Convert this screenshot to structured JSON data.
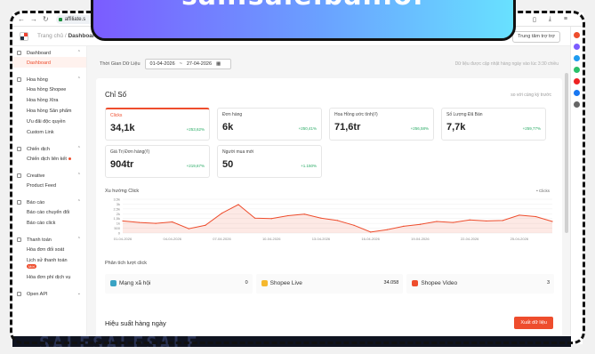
{
  "banner": {
    "text": "san.sale.ban.of"
  },
  "browser": {
    "url": "affiliate.s"
  },
  "header": {
    "crumb_root": "Trang chủ",
    "crumb_current": "Dashboard",
    "help_button": "Trung tâm trợ trợ"
  },
  "sidebar": {
    "groups": [
      {
        "label": "Dashboard",
        "items": [
          "Dashboard"
        ]
      },
      {
        "label": "Hoa hồng",
        "items": [
          "Hoa hồng Shopee",
          "Hoa hồng Xtra",
          "Hoa hồng Sản phẩm",
          "Ưu đãi độc quyền",
          "Custom Link"
        ]
      },
      {
        "label": "Chiến dịch",
        "items": [
          "Chiến dịch liên kết"
        ]
      },
      {
        "label": "Creative",
        "items": [
          "Product Feed"
        ]
      },
      {
        "label": "Báo cáo",
        "items": [
          "Báo cáo chuyển đổi",
          "Báo cáo click"
        ]
      },
      {
        "label": "Thanh toán",
        "items": [
          "Hóa đơn đối soát",
          "Lịch sử thanh toán",
          "Hóa đơn phí dịch vụ"
        ]
      },
      {
        "label": "Open API",
        "items": []
      }
    ],
    "badge": "Mới"
  },
  "filter": {
    "label": "Thời Gian Dữ Liệu",
    "start": "01-04-2026",
    "end": "27-04-2026",
    "sep": "~",
    "note": "Dữ liệu được cập nhật hàng ngày vào lúc 3:30 chiều"
  },
  "metrics_section": {
    "title": "Chỉ Số",
    "compare": "so với cùng kỳ trước",
    "items": [
      {
        "label": "Clicks",
        "value": "34,1k",
        "change": "+253,62%"
      },
      {
        "label": "Đơn hàng",
        "value": "6k",
        "change": "+250,41%"
      },
      {
        "label": "Hoa Hồng ước tính(₫)",
        "value": "71,6tr",
        "change": "+256,58%"
      },
      {
        "label": "Số Lượng Đã Bán",
        "value": "7,7k",
        "change": "+259,77%"
      },
      {
        "label": "Giá Trị Đơn hàng(₫)",
        "value": "904tr",
        "change": "+219,67%"
      },
      {
        "label": "Người mua mới",
        "value": "50",
        "change": "+1.150%"
      }
    ]
  },
  "chart_data": {
    "type": "area",
    "title": "Xu hướng Click",
    "legend": "Clicks",
    "x": [
      "01-04-2026",
      "02-04-2026",
      "03-04-2026",
      "04-04-2026",
      "05-04-2026",
      "06-04-2026",
      "07-04-2026",
      "08-04-2026",
      "09-04-2026",
      "10-04-2026",
      "11-04-2026",
      "12-04-2026",
      "13-04-2026",
      "14-04-2026",
      "15-04-2026",
      "16-04-2026",
      "17-04-2026",
      "18-04-2026",
      "19-04-2026",
      "20-04-2026",
      "21-04-2026",
      "22-04-2026",
      "23-04-2026",
      "24-04-2026",
      "25-04-2026",
      "26-04-2026",
      "27-04-2026"
    ],
    "xticks": [
      "01-04-2026",
      "04-04-2026",
      "07-04-2026",
      "10-04-2026",
      "13-04-2026",
      "16-04-2026",
      "19-04-2026",
      "22-04-2026",
      "25-04-2026"
    ],
    "yticks": [
      "3,5k",
      "3k",
      "2,5k",
      "2k",
      "1,5k",
      "1k",
      "500",
      "0"
    ],
    "values": [
      1250,
      1100,
      1000,
      1150,
      450,
      800,
      2050,
      2950,
      1550,
      1500,
      1800,
      1950,
      1550,
      1300,
      800,
      100,
      350,
      700,
      900,
      1200,
      1100,
      1350,
      1250,
      1300,
      1850,
      1700,
      1200
    ],
    "ylim": [
      0,
      3500
    ],
    "grid": true
  },
  "breakdown": {
    "title": "Phân tích lượt click",
    "items": [
      {
        "label": "Mạng xã hội",
        "value": "0",
        "color": "#3aa3c4"
      },
      {
        "label": "Shopee Live",
        "value": "34.058",
        "color": "#f5b82e"
      },
      {
        "label": "Shopee Video",
        "value": "3",
        "color": "#ee4d2d"
      }
    ]
  },
  "daily": {
    "title": "Hiệu suất hàng ngày",
    "export_label": "Xuất dữ liệu"
  },
  "footer_overlay": "SALESALESALE"
}
